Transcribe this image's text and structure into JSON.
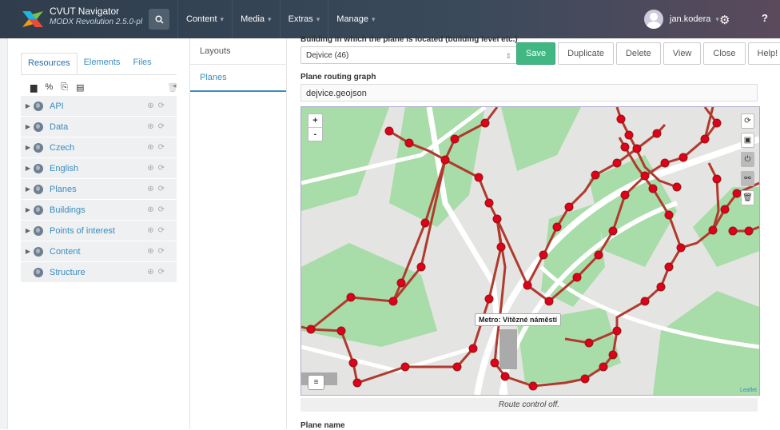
{
  "app": {
    "title": "CVUT Navigator",
    "subtitle": "MODX Revolution 2.5.0-pl"
  },
  "topnav": [
    "Content",
    "Media",
    "Extras",
    "Manage"
  ],
  "user": {
    "name": "jan.kodera"
  },
  "left_tabs": [
    "Resources",
    "Elements",
    "Files"
  ],
  "tree": [
    {
      "label": "API"
    },
    {
      "label": "Data"
    },
    {
      "label": "Czech"
    },
    {
      "label": "English"
    },
    {
      "label": "Planes"
    },
    {
      "label": "Buildings"
    },
    {
      "label": "Points of interest"
    },
    {
      "label": "Content"
    },
    {
      "label": "Structure"
    }
  ],
  "mid_items": [
    "Layouts",
    "Planes"
  ],
  "form": {
    "building_label": "Building in which the plane is located (building level etc.)",
    "building_value": "Dejvice (46)",
    "graph_label": "Plane routing graph",
    "graph_value": "dejvice.geojson",
    "plane_name_label": "Plane name"
  },
  "actions": [
    "Save",
    "Duplicate",
    "Delete",
    "View",
    "Close",
    "Help!"
  ],
  "map": {
    "zoom_in": "+",
    "zoom_out": "-",
    "tooltip": "Metro: Vítězné náměstí",
    "attribution": "Leaflet",
    "status": "Route control off."
  },
  "colors": {
    "route": "#b03a2e",
    "node": "#e0001b",
    "park": "#a8dca8",
    "accent": "#3c8dbc",
    "save": "#41b883"
  }
}
